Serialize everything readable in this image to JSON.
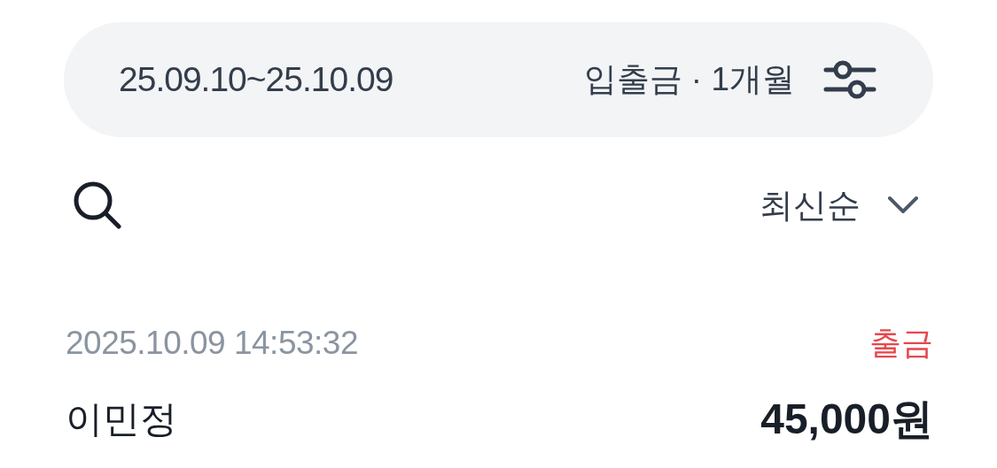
{
  "filter_bar": {
    "date_range": "25.09.10~25.10.09",
    "summary": "입출금 · 1개월"
  },
  "sort": {
    "label": "최신순"
  },
  "transactions": [
    {
      "datetime": "2025.10.09 14:53:32",
      "type": "출금",
      "kind": "withdrawal",
      "name": "이민정",
      "amount": "45,000원"
    }
  ]
}
